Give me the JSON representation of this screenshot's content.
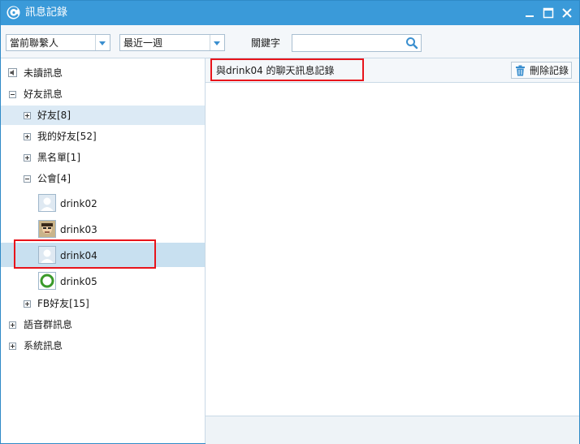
{
  "window": {
    "title": "訊息記錄"
  },
  "toolbar": {
    "contacts_select": "當前聯繫人",
    "range_select": "最近一週",
    "keyword_label": "關鍵字",
    "keyword_value": "",
    "keyword_placeholder": ""
  },
  "tree": {
    "unread": "未讀訊息",
    "friends_group": "好友訊息",
    "friends": "好友[8]",
    "my_friends": "我的好友[52]",
    "blacklist": "黑名單[1]",
    "guild": "公會[4]",
    "members": [
      "drink02",
      "drink03",
      "drink04",
      "drink05"
    ],
    "fb_friends": "FB好友[15]",
    "voice_group": "語音群訊息",
    "system": "系統訊息"
  },
  "panel": {
    "title": "與drink04 的聊天訊息記錄",
    "delete_label": "刪除記錄"
  },
  "colors": {
    "titlebar": "#3a9ad9",
    "highlight": "#e8141b",
    "selected": "#c8e0f0"
  }
}
